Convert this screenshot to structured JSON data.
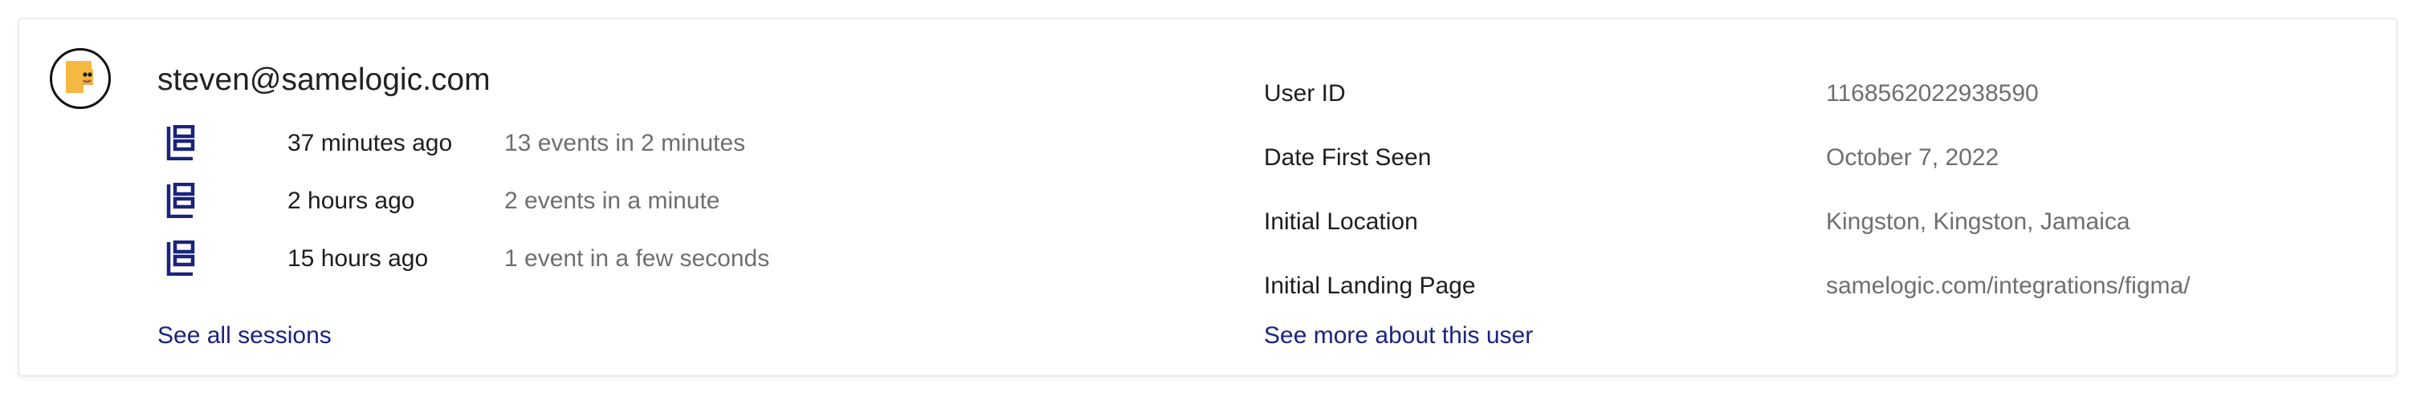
{
  "user": {
    "email": "steven@samelogic.com"
  },
  "sessions": [
    {
      "time": "37 minutes ago",
      "summary": "13 events in 2 minutes"
    },
    {
      "time": "2 hours ago",
      "summary": "2 events in a minute"
    },
    {
      "time": "15 hours ago",
      "summary": "1 event in a few seconds"
    }
  ],
  "links": {
    "see_all_sessions": "See all sessions",
    "see_more_user": "See more about this user"
  },
  "info": [
    {
      "label": "User ID",
      "value": "1168562022938590"
    },
    {
      "label": "Date First Seen",
      "value": "October 7, 2022"
    },
    {
      "label": "Initial Location",
      "value": "Kingston, Kingston, Jamaica"
    },
    {
      "label": "Initial Landing Page",
      "value": "samelogic.com/integrations/figma/"
    }
  ],
  "colors": {
    "link": "#1a237e",
    "session_icon": "#1a237e",
    "avatar_accent": "#f5b942",
    "muted_text": "#6f6f6f"
  },
  "icons": {
    "avatar": "avatar-icon",
    "session": "session-icon"
  }
}
